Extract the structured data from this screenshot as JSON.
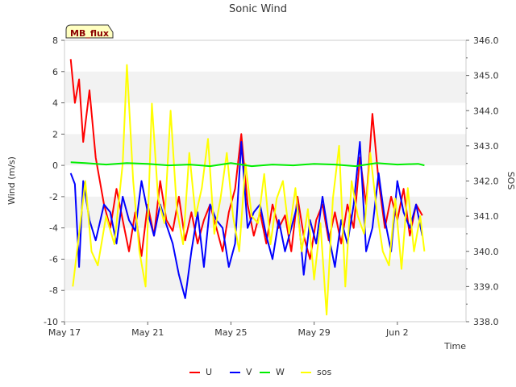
{
  "chart_data": {
    "type": "line",
    "title": "Sonic Wind",
    "badge": "MB_flux",
    "xlabel": "Time",
    "ylabel": "Wind (m/s)",
    "ylabel_right": "SOS",
    "xlim": [
      0,
      19.3
    ],
    "ylim": [
      -10,
      8
    ],
    "ylim_right": [
      338.0,
      346.0
    ],
    "x_ticks": [
      {
        "x": 0,
        "label": "May 17"
      },
      {
        "x": 4,
        "label": "May 21"
      },
      {
        "x": 8,
        "label": "May 25"
      },
      {
        "x": 12,
        "label": "May 29"
      },
      {
        "x": 16,
        "label": "Jun 2"
      }
    ],
    "y_ticks": [
      -10,
      -8,
      -6,
      -4,
      -2,
      0,
      2,
      4,
      6,
      8
    ],
    "y_ticks_right": [
      "338.0",
      "339.0",
      "340.0",
      "341.0",
      "342.0",
      "343.0",
      "344.0",
      "345.0",
      "346.0"
    ],
    "grid": "horizontal bands",
    "legend_position": "bottom",
    "series": [
      {
        "name": "U",
        "color": "#ff0000",
        "axis": "left",
        "x": [
          0.3,
          0.5,
          0.7,
          0.9,
          1.2,
          1.5,
          1.9,
          2.2,
          2.5,
          2.8,
          3.1,
          3.4,
          3.7,
          4.0,
          4.3,
          4.6,
          4.9,
          5.2,
          5.5,
          5.8,
          6.1,
          6.4,
          6.7,
          7.0,
          7.3,
          7.6,
          7.9,
          8.2,
          8.5,
          8.8,
          9.1,
          9.4,
          9.7,
          10.0,
          10.3,
          10.6,
          10.9,
          11.2,
          11.5,
          11.8,
          12.1,
          12.4,
          12.7,
          13.0,
          13.3,
          13.6,
          13.9,
          14.2,
          14.5,
          14.8,
          15.1,
          15.4,
          15.7,
          16.0,
          16.3,
          16.6,
          16.9,
          17.2
        ],
        "y": [
          6.8,
          4.0,
          5.5,
          1.5,
          4.8,
          0.5,
          -2.5,
          -4.0,
          -1.5,
          -3.5,
          -5.5,
          -3.0,
          -5.8,
          -2.5,
          -4.5,
          -1.0,
          -3.5,
          -4.2,
          -2.0,
          -4.8,
          -3.0,
          -5.0,
          -3.5,
          -2.5,
          -4.0,
          -5.5,
          -3.0,
          -1.5,
          2.0,
          -2.5,
          -4.5,
          -3.0,
          -5.0,
          -2.5,
          -4.0,
          -3.2,
          -5.5,
          -2.0,
          -4.5,
          -6.0,
          -3.5,
          -2.5,
          -4.8,
          -3.0,
          -5.0,
          -2.5,
          -4.0,
          0.5,
          -2.5,
          3.3,
          -1.0,
          -4.0,
          -2.0,
          -3.5,
          -1.5,
          -4.5,
          -2.5,
          -3.2
        ]
      },
      {
        "name": "V",
        "color": "#0000ff",
        "axis": "left",
        "x": [
          0.3,
          0.5,
          0.7,
          0.9,
          1.2,
          1.5,
          1.9,
          2.2,
          2.5,
          2.8,
          3.1,
          3.4,
          3.7,
          4.0,
          4.3,
          4.6,
          4.9,
          5.2,
          5.5,
          5.8,
          6.1,
          6.4,
          6.7,
          7.0,
          7.3,
          7.6,
          7.9,
          8.2,
          8.5,
          8.8,
          9.1,
          9.4,
          9.7,
          10.0,
          10.3,
          10.6,
          10.9,
          11.2,
          11.5,
          11.8,
          12.1,
          12.4,
          12.7,
          13.0,
          13.3,
          13.6,
          13.9,
          14.2,
          14.5,
          14.8,
          15.1,
          15.4,
          15.7,
          16.0,
          16.3,
          16.6,
          16.9,
          17.2
        ],
        "y": [
          -0.5,
          -1.2,
          -6.5,
          -1.0,
          -3.5,
          -4.8,
          -2.5,
          -3.0,
          -5.0,
          -2.0,
          -3.5,
          -4.2,
          -1.0,
          -3.0,
          -4.5,
          -2.5,
          -3.8,
          -5.0,
          -7.0,
          -8.5,
          -5.5,
          -3.0,
          -6.5,
          -2.5,
          -3.5,
          -4.0,
          -6.5,
          -5.0,
          1.5,
          -4.0,
          -3.0,
          -2.5,
          -4.5,
          -6.0,
          -3.5,
          -5.5,
          -4.0,
          -2.5,
          -7.0,
          -3.5,
          -5.0,
          -2.0,
          -4.5,
          -6.5,
          -3.5,
          -5.0,
          -2.5,
          1.5,
          -5.5,
          -4.0,
          -0.5,
          -3.5,
          -5.5,
          -1.0,
          -3.0,
          -4.0,
          -2.5,
          -4.5
        ]
      },
      {
        "name": "W",
        "color": "#00ee00",
        "axis": "left",
        "x": [
          0.3,
          1.0,
          2.0,
          3.0,
          4.0,
          5.0,
          6.0,
          7.0,
          8.0,
          9.0,
          10.0,
          11.0,
          12.0,
          13.0,
          14.0,
          15.0,
          16.0,
          17.0,
          17.3
        ],
        "y": [
          0.2,
          0.15,
          0.05,
          0.15,
          0.1,
          0.0,
          0.05,
          -0.05,
          0.15,
          -0.05,
          0.05,
          0.0,
          0.1,
          0.05,
          -0.05,
          0.15,
          0.05,
          0.1,
          0.0
        ]
      },
      {
        "name": "sos",
        "color": "#ffff00",
        "axis": "right",
        "x": [
          0.4,
          0.7,
          1.0,
          1.3,
          1.6,
          2.0,
          2.4,
          2.8,
          3.0,
          3.3,
          3.6,
          3.9,
          4.2,
          4.5,
          4.8,
          5.1,
          5.4,
          5.7,
          6.0,
          6.3,
          6.6,
          6.9,
          7.2,
          7.5,
          7.8,
          8.1,
          8.4,
          8.7,
          9.0,
          9.3,
          9.6,
          9.9,
          10.2,
          10.5,
          10.8,
          11.1,
          11.4,
          11.7,
          12.0,
          12.3,
          12.6,
          12.9,
          13.2,
          13.5,
          13.8,
          14.1,
          14.4,
          14.7,
          15.0,
          15.3,
          15.6,
          15.9,
          16.2,
          16.5,
          16.8,
          17.1,
          17.3
        ],
        "y": [
          339.0,
          340.5,
          342.0,
          340.0,
          339.6,
          341.0,
          340.2,
          342.5,
          345.3,
          342.0,
          340.0,
          339.0,
          344.2,
          341.5,
          340.8,
          344.0,
          341.2,
          340.2,
          342.8,
          341.0,
          341.8,
          343.2,
          340.5,
          341.5,
          342.8,
          341.0,
          340.0,
          342.5,
          341.0,
          340.8,
          342.2,
          340.2,
          341.5,
          342.0,
          340.5,
          341.8,
          340.0,
          341.2,
          339.2,
          340.8,
          338.2,
          341.5,
          343.0,
          339.0,
          342.0,
          341.0,
          340.5,
          342.8,
          341.2,
          340.0,
          339.6,
          341.5,
          339.5,
          341.8,
          340.0,
          341.0,
          340.0
        ]
      }
    ]
  }
}
